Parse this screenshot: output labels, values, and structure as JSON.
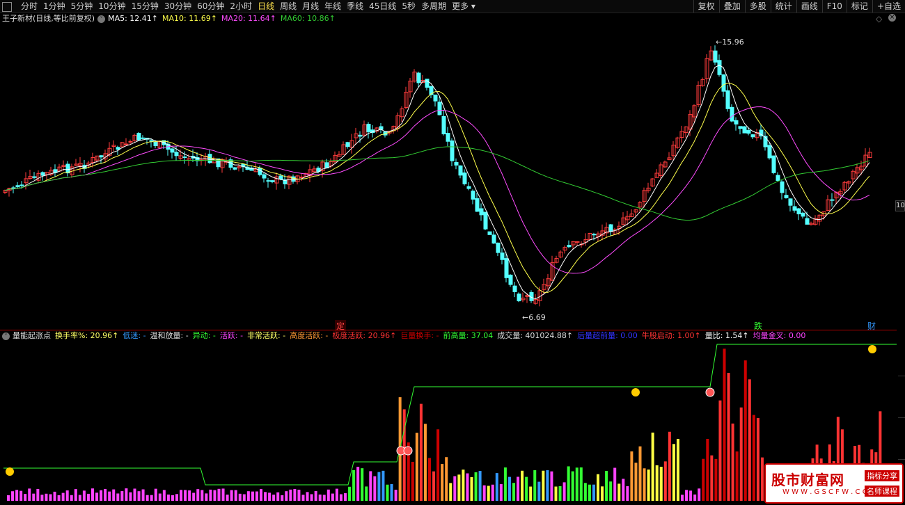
{
  "topbar": {
    "periods": [
      "分时",
      "1分钟",
      "5分钟",
      "10分钟",
      "15分钟",
      "30分钟",
      "60分钟",
      "2小时",
      "日线",
      "周线",
      "月线",
      "年线",
      "季线",
      "45日线",
      "5秒",
      "多周期",
      "更多 ▾"
    ],
    "active_period": "日线",
    "tools": [
      "复权",
      "叠加",
      "多股",
      "统计",
      "画线",
      "F10",
      "标记",
      "+自选"
    ]
  },
  "main_legend": {
    "title": "王子新材(日线,等比前复权)",
    "ma5": "MA5: 12.41↑",
    "ma10": "MA10: 11.69↑",
    "ma20": "MA20: 11.64↑",
    "ma60": "MA60: 10.86↑"
  },
  "price_chart": {
    "high_label": "15.96",
    "low_label": "6.69",
    "right_price_label": "10",
    "colors": {
      "up": "#ff3c3c",
      "down": "#54ffff",
      "ma5": "#ffffff",
      "ma10": "#ffff4c",
      "ma20": "#ff4cff",
      "ma60": "#33cc33"
    }
  },
  "markers": {
    "ding": "定",
    "die": "跌",
    "cai": "财"
  },
  "sub_legend": {
    "name": "量能起涨点",
    "items": [
      {
        "text": "换手率%: 20.96↑",
        "color": "#ffff66"
      },
      {
        "text": "低迷: -",
        "color": "#3399ff"
      },
      {
        "text": "温和放量: -",
        "color": "#dddddd"
      },
      {
        "text": "异动: -",
        "color": "#33ff33"
      },
      {
        "text": "活跃: -",
        "color": "#ff44ff"
      },
      {
        "text": "非常活跃: -",
        "color": "#ffff66"
      },
      {
        "text": "高度活跃: -",
        "color": "#ff9933"
      },
      {
        "text": "极度活跃: 20.96↑",
        "color": "#ff3333"
      },
      {
        "text": "巨量换手: -",
        "color": "#cc0000"
      },
      {
        "text": "前高量: 37.04",
        "color": "#33ff33"
      },
      {
        "text": "成交量: 401024.88↑",
        "color": "#dddddd"
      },
      {
        "text": "后量超前量: 0.00",
        "color": "#3333ff"
      },
      {
        "text": "牛股启动: 1.00↑",
        "color": "#ff3333"
      },
      {
        "text": "量比: 1.54↑",
        "color": "#ffffff"
      },
      {
        "text": "均量金叉: 0.00",
        "color": "#ff44ff"
      }
    ]
  },
  "watermark": {
    "site": "股市财富网",
    "url": "W W W . G S C F W . C O M",
    "badge1": "指标分享",
    "badge2": "名师课程"
  }
}
